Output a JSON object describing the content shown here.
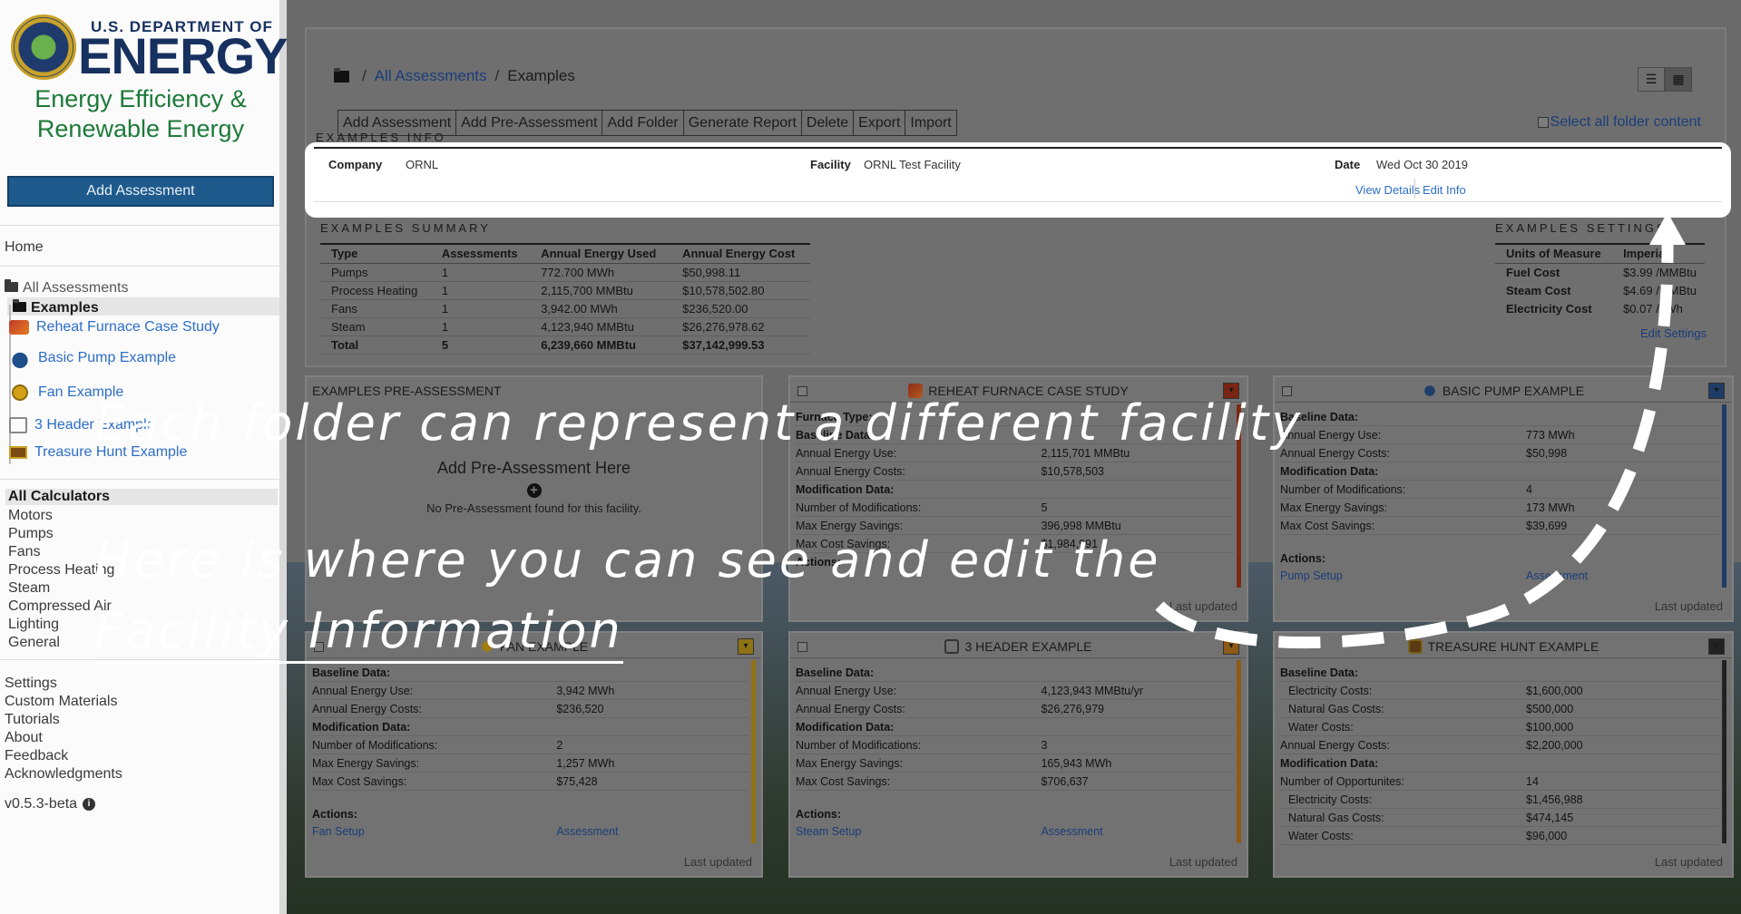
{
  "branding": {
    "dept": "U.S. DEPARTMENT OF",
    "energy": "ENERGY",
    "eere_line1": "Energy Efficiency &",
    "eere_line2": "Renewable Energy"
  },
  "sidebar": {
    "add_assessment": "Add Assessment",
    "home": "Home",
    "all_assessments": "All Assessments",
    "current_folder": "Examples",
    "items": [
      {
        "label": "Reheat Furnace Case Study",
        "icon": "furnace-icon"
      },
      {
        "label": "Basic Pump Example",
        "icon": "pump-icon"
      },
      {
        "label": "Fan Example",
        "icon": "fan-icon"
      },
      {
        "label": "3 Header Example",
        "icon": "factory-icon"
      },
      {
        "label": "Treasure Hunt Example",
        "icon": "treasure-chest-icon"
      }
    ],
    "calculators_heading": "All Calculators",
    "calculators": [
      "Motors",
      "Pumps",
      "Fans",
      "Process Heating",
      "Steam",
      "Compressed Air",
      "Lighting",
      "General"
    ],
    "footer_links": [
      "Settings",
      "Custom Materials",
      "Tutorials",
      "About",
      "Feedback",
      "Acknowledgments"
    ],
    "version": "v0.5.3-beta"
  },
  "breadcrumb": {
    "root": "All Assessments",
    "current": "Examples"
  },
  "toolbar": [
    "Add Assessment",
    "Add Pre-Assessment",
    "Add Folder",
    "Generate Report",
    "Delete",
    "Export",
    "Import"
  ],
  "select_all": "Select all folder content",
  "info": {
    "section": "EXAMPLES INFO",
    "company_label": "Company",
    "company": "ORNL",
    "facility_label": "Facility",
    "facility": "ORNL Test Facility",
    "date_label": "Date",
    "date": "Wed Oct 30 2019",
    "view_details": "View Details",
    "edit_info": "Edit Info"
  },
  "summary": {
    "section": "EXAMPLES SUMMARY",
    "columns": [
      "Type",
      "Assessments",
      "Annual Energy Used",
      "Annual Energy Cost"
    ],
    "rows": [
      [
        "Pumps",
        "1",
        "772.700 MWh",
        "$50,998.11"
      ],
      [
        "Process Heating",
        "1",
        "2,115,700 MMBtu",
        "$10,578,502.80"
      ],
      [
        "Fans",
        "1",
        "3,942.00 MWh",
        "$236,520.00"
      ],
      [
        "Steam",
        "1",
        "4,123,940 MMBtu",
        "$26,276,978.62"
      ],
      [
        "Total",
        "5",
        "6,239,660 MMBtu",
        "$37,142,999.53"
      ]
    ]
  },
  "settings": {
    "section": "EXAMPLES SETTINGS",
    "columns": [
      "Units of Measure",
      "Imperial"
    ],
    "rows": [
      [
        "Fuel Cost",
        "$3.99 /MMBtu"
      ],
      [
        "Steam Cost",
        "$4.69 /MMBtu"
      ],
      [
        "Electricity Cost",
        "$0.07 /kWh"
      ]
    ],
    "edit": "Edit Settings"
  },
  "pre_assessment": {
    "title": "EXAMPLES PRE-ASSESSMENT",
    "heading": "Add Pre-Assessment Here",
    "empty": "No Pre-Assessment found for this facility."
  },
  "cards": {
    "furnace": {
      "title": "REHEAT FURNACE CASE STUDY",
      "rows": [
        [
          "Furnace Type:",
          "",
          "section"
        ],
        [
          "Baseline Data:",
          "",
          "section"
        ],
        [
          "Annual Energy Use:",
          "2,115,701 MMBtu",
          ""
        ],
        [
          "Annual Energy Costs:",
          "$10,578,503",
          ""
        ],
        [
          "Modification Data:",
          "",
          "section"
        ],
        [
          "Number of Modifications:",
          "5",
          ""
        ],
        [
          "Max Energy Savings:",
          "396,998 MMBtu",
          ""
        ],
        [
          "Max Cost Savings:",
          "$1,984,991",
          ""
        ]
      ],
      "actions": "Actions:",
      "foot": "Last updated"
    },
    "pump": {
      "title": "BASIC PUMP EXAMPLE",
      "rows": [
        [
          "Baseline Data:",
          "",
          "section"
        ],
        [
          "Annual Energy Use:",
          "773 MWh",
          ""
        ],
        [
          "Annual Energy Costs:",
          "$50,998",
          ""
        ],
        [
          "Modification Data:",
          "",
          "section"
        ],
        [
          "Number of Modifications:",
          "4",
          ""
        ],
        [
          "Max Energy Savings:",
          "173 MWh",
          ""
        ],
        [
          "Max Cost Savings:",
          "$39,699",
          ""
        ]
      ],
      "actions": "Actions:",
      "link1": "Pump Setup",
      "link2": "Assessment",
      "foot": "Last updated"
    },
    "fan": {
      "title": "FAN EXAMPLE",
      "rows": [
        [
          "Baseline Data:",
          "",
          "section"
        ],
        [
          "Annual Energy Use:",
          "3,942 MWh",
          ""
        ],
        [
          "Annual Energy Costs:",
          "$236,520",
          ""
        ],
        [
          "Modification Data:",
          "",
          "section"
        ],
        [
          "Number of Modifications:",
          "2",
          ""
        ],
        [
          "Max Energy Savings:",
          "1,257 MWh",
          ""
        ],
        [
          "Max Cost Savings:",
          "$75,428",
          ""
        ]
      ],
      "actions": "Actions:",
      "link1": "Fan Setup",
      "link2": "Assessment",
      "foot": "Last updated"
    },
    "header": {
      "title": "3 HEADER EXAMPLE",
      "rows": [
        [
          "Baseline Data:",
          "",
          "section"
        ],
        [
          "Annual Energy Use:",
          "4,123,943 MMBtu/yr",
          ""
        ],
        [
          "Annual Energy Costs:",
          "$26,276,979",
          ""
        ],
        [
          "Modification Data:",
          "",
          "section"
        ],
        [
          "Number of Modifications:",
          "3",
          ""
        ],
        [
          "Max Energy Savings:",
          "165,943 MWh",
          ""
        ],
        [
          "Max Cost Savings:",
          "$706,637",
          ""
        ]
      ],
      "actions": "Actions:",
      "link1": "Steam Setup",
      "link2": "Assessment",
      "foot": "Last updated"
    },
    "treasure": {
      "title": "TREASURE HUNT EXAMPLE",
      "rows": [
        [
          "Baseline Data:",
          "",
          "section"
        ],
        [
          "Electricity Costs:",
          "$1,600,000",
          "indent"
        ],
        [
          "Natural Gas Costs:",
          "$500,000",
          "indent"
        ],
        [
          "Water Costs:",
          "$100,000",
          "indent"
        ],
        [
          "Annual Energy Costs:",
          "$2,200,000",
          ""
        ],
        [
          "Modification Data:",
          "",
          "section"
        ],
        [
          "Number of Opportunites:",
          "14",
          ""
        ],
        [
          "Electricity Costs:",
          "$1,456,988",
          "indent"
        ],
        [
          "Natural Gas Costs:",
          "$474,145",
          "indent"
        ],
        [
          "Water Costs:",
          "$96,000",
          "indent"
        ]
      ],
      "foot": "Last updated"
    }
  },
  "annotations": {
    "line1": "Each folder can represent a different facility",
    "line2": "Here is where you can see and edit the",
    "line3": "Facility Information"
  }
}
